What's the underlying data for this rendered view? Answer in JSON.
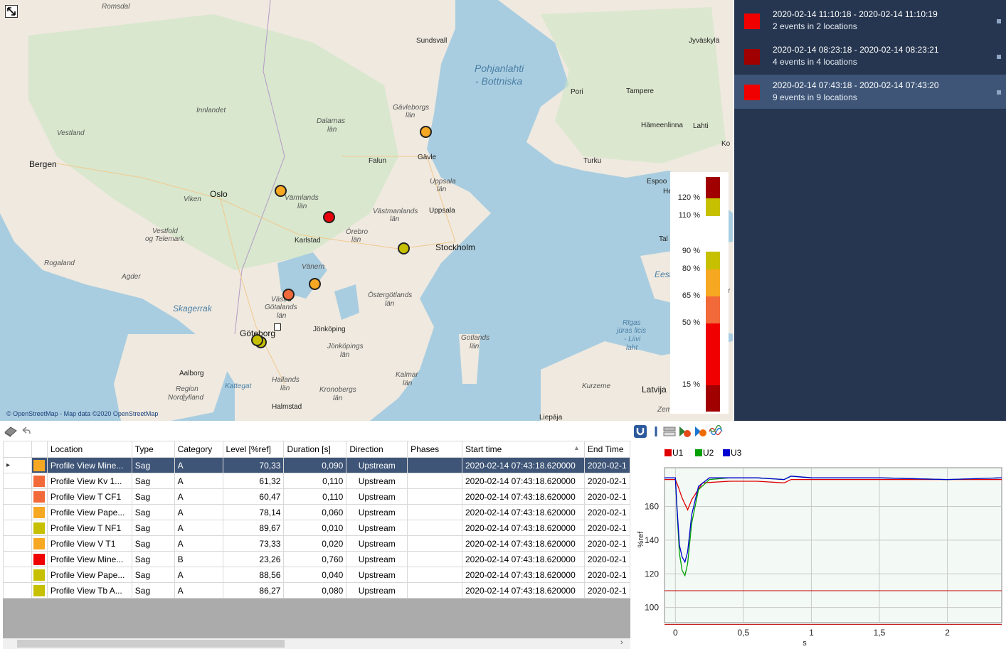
{
  "map": {
    "credit": "© OpenStreetMap - Map data ©2020 OpenStreetMap",
    "labels": {
      "romsdal": "Romsdal",
      "sundsvall": "Sundsvall",
      "jyvaskyla": "Jyväskylä",
      "pohjanlahti1": "Pohjanlahti",
      "pohjanlahti2": "- Bottniska",
      "pori": "Pori",
      "tampere": "Tampere",
      "innlandet": "Innlandet",
      "vestland": "Vestland",
      "gavleborgs1": "Gävleborgs",
      "gavleborgs2": "län",
      "dalarnas1": "Dalarnas",
      "dalarnas2": "län",
      "hameenlinna": "Hämeenlinna",
      "lahti": "Lahti",
      "ko": "Ko",
      "bergen": "Bergen",
      "falun": "Falun",
      "gavle": "Gävle",
      "turku": "Turku",
      "espoo": "Espoo",
      "he": "He",
      "oslo": "Oslo",
      "viken": "Viken",
      "varmlands1": "Värmlands",
      "varmlands2": "län",
      "uppsala_lan1": "Uppsala",
      "uppsala_lan2": "län",
      "vastmanlands1": "Västmanlands",
      "vastmanlands2": "län",
      "uppsala": "Uppsala",
      "tal": "Tal",
      "vestfold1": "Vestfold",
      "vestfold2": "og Telemark",
      "karlstad": "Karlstad",
      "orebro1": "Örebro",
      "orebro2": "län",
      "stockholm": "Stockholm",
      "rogaland": "Rogaland",
      "agder": "Agder",
      "vanern": "Vänern",
      "eest": "Eest",
      "skagerrak": "Skagerrak",
      "vastra1": "Västra",
      "vastra2": "Götalands",
      "vastra3": "län",
      "ostergotlands1": "Östergötlands",
      "ostergotlands2": "län",
      "goteborg": "Göteborg",
      "jonkoping": "Jönköping",
      "rigas1": "Rīgas",
      "rigas2": "jūras līcis",
      "rigas3": "- Liivi",
      "rigas4": "laht",
      "jonkopings1": "Jönköpings",
      "jonkopings2": "län",
      "gotlands1": "Gotlands",
      "gotlands2": "län",
      "aalborg": "Aalborg",
      "kattegat": "Kattegat",
      "region1": "Region",
      "region2": "Nordjylland",
      "hallands1": "Hallands",
      "hallands2": "län",
      "kronobergs1": "Kronobergs",
      "kronobergs2": "län",
      "kalmar1": "Kalmar",
      "kalmar2": "län",
      "kurzeme": "Kurzeme",
      "latvija": "Latvija",
      "halmstad": "Halmstad",
      "zem": "Zem",
      "liepaja": "Liepāja",
      "r": "r"
    },
    "marker_colors": [
      "#f7a823",
      "#f7a823",
      "#e8000b",
      "#c6c000",
      "#f7a823",
      "#f26a3a",
      "#c6c000",
      "#c6c000"
    ]
  },
  "legend": {
    "ticks": [
      "120 %",
      "110 %",
      "90 %",
      "80 %",
      "65 %",
      "50 %",
      "15 %"
    ],
    "colors": {
      "dark_red": "#a00000",
      "yellow_green": "#c6c000",
      "orange": "#f7a823",
      "orange_red": "#f26a3a",
      "red": "#f00000"
    }
  },
  "events": [
    {
      "range": "2020-02-14 11:10:18 - 2020-02-14 11:10:19",
      "summary": "2 events in 2 locations",
      "color": "#f00000"
    },
    {
      "range": "2020-02-14 08:23:18 - 2020-02-14 08:23:21",
      "summary": "4 events in 4 locations",
      "color": "#a00000"
    },
    {
      "range": "2020-02-14 07:43:18 - 2020-02-14 07:43:20",
      "summary": "9 events in 9 locations",
      "color": "#f00000"
    }
  ],
  "table": {
    "columns": [
      "Location",
      "Type",
      "Category",
      "Level [%ref]",
      "Duration [s]",
      "Direction",
      "Phases",
      "Start time",
      "End Time"
    ],
    "rows": [
      {
        "color": "#f7a823",
        "location": "Profile View Mine...",
        "type": "Sag",
        "category": "A",
        "level": "70,33",
        "duration": "0,090",
        "direction": "Upstream",
        "phases": "",
        "start": "2020-02-14 07:43:18.620000",
        "end": "2020-02-1"
      },
      {
        "color": "#f26a3a",
        "location": "Profile View Kv 1...",
        "type": "Sag",
        "category": "A",
        "level": "61,32",
        "duration": "0,110",
        "direction": "Upstream",
        "phases": "",
        "start": "2020-02-14 07:43:18.620000",
        "end": "2020-02-1"
      },
      {
        "color": "#f26a3a",
        "location": "Profile View T CF1",
        "type": "Sag",
        "category": "A",
        "level": "60,47",
        "duration": "0,110",
        "direction": "Upstream",
        "phases": "",
        "start": "2020-02-14 07:43:18.620000",
        "end": "2020-02-1"
      },
      {
        "color": "#f7a823",
        "location": "Profile View Pape...",
        "type": "Sag",
        "category": "A",
        "level": "78,14",
        "duration": "0,060",
        "direction": "Upstream",
        "phases": "",
        "start": "2020-02-14 07:43:18.620000",
        "end": "2020-02-1"
      },
      {
        "color": "#c6c000",
        "location": "Profile View T NF1",
        "type": "Sag",
        "category": "A",
        "level": "89,67",
        "duration": "0,010",
        "direction": "Upstream",
        "phases": "",
        "start": "2020-02-14 07:43:18.620000",
        "end": "2020-02-1"
      },
      {
        "color": "#f7a823",
        "location": "Profile View V T1",
        "type": "Sag",
        "category": "A",
        "level": "73,33",
        "duration": "0,020",
        "direction": "Upstream",
        "phases": "",
        "start": "2020-02-14 07:43:18.620000",
        "end": "2020-02-1"
      },
      {
        "color": "#f00000",
        "location": "Profile View Mine...",
        "type": "Sag",
        "category": "B",
        "level": "23,26",
        "duration": "0,760",
        "direction": "Upstream",
        "phases": "",
        "start": "2020-02-14 07:43:18.620000",
        "end": "2020-02-1"
      },
      {
        "color": "#c6c000",
        "location": "Profile View Pape...",
        "type": "Sag",
        "category": "A",
        "level": "88,56",
        "duration": "0,040",
        "direction": "Upstream",
        "phases": "",
        "start": "2020-02-14 07:43:18.620000",
        "end": "2020-02-1"
      },
      {
        "color": "#c6c000",
        "location": "Profile View Tb A...",
        "type": "Sag",
        "category": "A",
        "level": "86,27",
        "duration": "0,080",
        "direction": "Upstream",
        "phases": "",
        "start": "2020-02-14 07:43:18.620000",
        "end": "2020-02-1"
      }
    ]
  },
  "chart_toolbar": {
    "icons": [
      "magnet-icon",
      "cursor-icon",
      "layout-icon",
      "export-icon",
      "play-icon",
      "phases-icon"
    ]
  },
  "chart_data": {
    "type": "line",
    "xlabel": "s",
    "ylabel": "%ref",
    "x_ticks": [
      "0",
      "0,5",
      "1",
      "1,5",
      "2"
    ],
    "y_ticks": [
      "100",
      "120",
      "140",
      "160"
    ],
    "xlim": [
      -0.08,
      2.4
    ],
    "ylim": [
      91,
      183
    ],
    "grid": true,
    "legend": "top-left",
    "thresholds": [
      {
        "value": 110,
        "color": "#c00000"
      },
      {
        "value": 90,
        "color": "#c00000"
      }
    ],
    "series": [
      {
        "name": "U1",
        "color": "#e00000",
        "x": [
          -0.08,
          0.0,
          0.02,
          0.05,
          0.09,
          0.12,
          0.2,
          0.4,
          0.6,
          0.8,
          0.85,
          1.0,
          1.5,
          2.0,
          2.4
        ],
        "y": [
          176,
          176,
          172,
          165,
          158,
          164,
          174,
          175,
          175,
          174,
          176,
          176,
          176,
          176,
          176
        ]
      },
      {
        "name": "U2",
        "color": "#00a000",
        "x": [
          -0.08,
          0.0,
          0.01,
          0.03,
          0.05,
          0.07,
          0.09,
          0.12,
          0.17,
          0.25,
          0.4,
          0.6,
          0.8,
          0.85,
          1.0,
          1.5,
          2.0,
          2.4
        ],
        "y": [
          177,
          177,
          160,
          132,
          122,
          119,
          126,
          150,
          170,
          176,
          177,
          177,
          176,
          178,
          177,
          177,
          176,
          177
        ]
      },
      {
        "name": "U3",
        "color": "#0000d0",
        "x": [
          -0.08,
          0.0,
          0.01,
          0.03,
          0.05,
          0.07,
          0.09,
          0.12,
          0.17,
          0.25,
          0.4,
          0.6,
          0.8,
          0.85,
          1.0,
          1.5,
          2.0,
          2.4
        ],
        "y": [
          177,
          177,
          162,
          137,
          130,
          127,
          133,
          155,
          172,
          177,
          177,
          177,
          176,
          178,
          177,
          177,
          176,
          177
        ]
      }
    ]
  }
}
